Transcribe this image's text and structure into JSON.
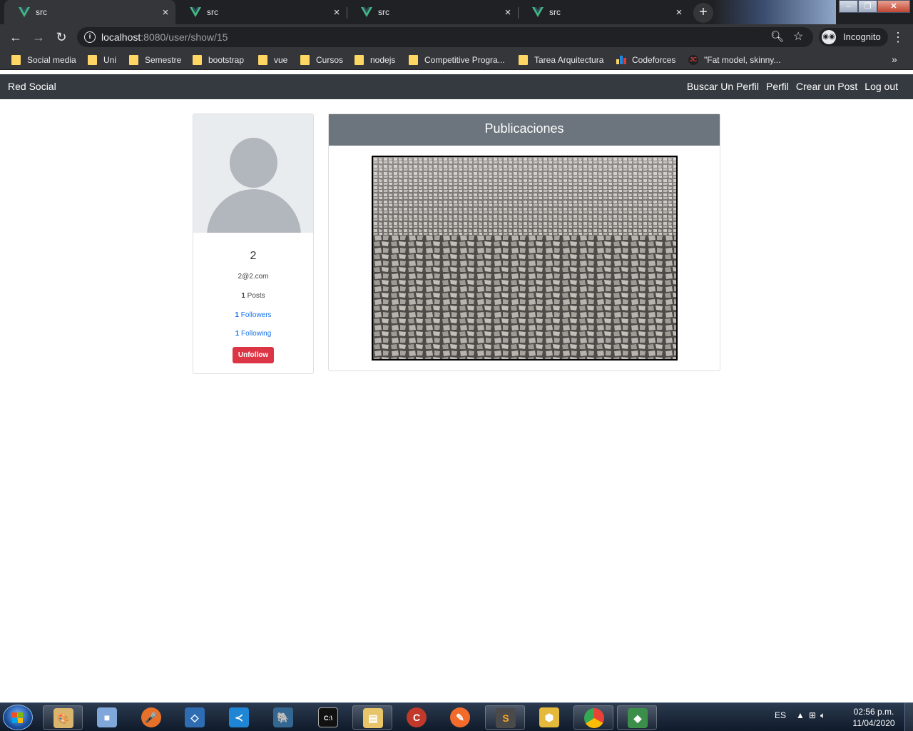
{
  "browser": {
    "tabs": [
      {
        "title": "src",
        "active": true
      },
      {
        "title": "src",
        "active": false
      },
      {
        "title": "src",
        "active": false
      },
      {
        "title": "src",
        "active": false
      }
    ],
    "new_tab": "+",
    "close_glyph": "×",
    "url_host": "localhost",
    "url_rest": ":8080/user/show/15",
    "incognito_label": "Incognito",
    "bookmarks": [
      {
        "label": "Social media",
        "icon": "folder-icon"
      },
      {
        "label": "Uni",
        "icon": "folder-icon"
      },
      {
        "label": "Semestre",
        "icon": "folder-icon"
      },
      {
        "label": "bootstrap",
        "icon": "folder-icon"
      },
      {
        "label": "vue",
        "icon": "folder-icon"
      },
      {
        "label": "Cursos",
        "icon": "folder-icon"
      },
      {
        "label": "nodejs",
        "icon": "folder-icon"
      },
      {
        "label": "Competitive Progra...",
        "icon": "folder-icon"
      },
      {
        "label": "Tarea Arquitectura",
        "icon": "folder-icon"
      },
      {
        "label": "Codeforces",
        "icon": "codeforces-icon"
      },
      {
        "label": "\"Fat model, skinny...",
        "icon": "jc-icon"
      }
    ],
    "more_bookmarks": "»"
  },
  "app": {
    "brand": "Red Social",
    "nav": [
      "Buscar Un Perfil",
      "Perfil",
      "Crear un Post",
      "Log out"
    ],
    "profile": {
      "name": "2",
      "email": "2@2.com",
      "posts_count": "1",
      "posts_label": "Posts",
      "followers_count": "1",
      "followers_label": "Followers",
      "following_count": "1",
      "following_label": "Following",
      "unfollow_label": "Unfollow"
    },
    "posts": {
      "header": "Publicaciones"
    }
  },
  "taskbar": {
    "language": "ES",
    "time": "02:56 p.m.",
    "date": "11/04/2020"
  },
  "colors": {
    "navbar_bg": "#343a40",
    "posts_header_bg": "#6c757d",
    "unfollow_bg": "#dc3545",
    "link": "#1a73e8"
  }
}
